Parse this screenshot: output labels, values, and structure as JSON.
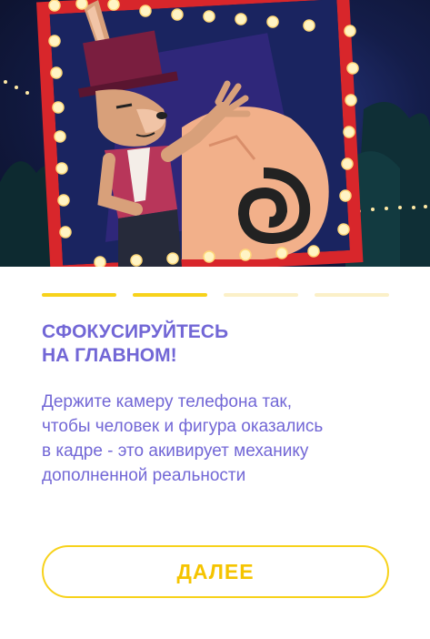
{
  "hero": {
    "image_name": "ar-rabbit-illustration",
    "colors": {
      "frame": "#d8262b",
      "bulb": "#fff4c4",
      "sky": "#141d4a"
    }
  },
  "progress": {
    "total": 4,
    "current": 2
  },
  "title": {
    "line1": "СФОКУСИРУЙТЕСЬ",
    "line2": "НА ГЛАВНОМ!"
  },
  "description": {
    "line1": "Держите камеру телефона так,",
    "line2": "чтобы человек и фигура оказались",
    "line3": "в кадре - это акивирует механику",
    "line4": "дополненной реальности"
  },
  "button": {
    "label": "ДАЛЕЕ"
  },
  "colors": {
    "accent": "#f7d21b",
    "text": "#7267d6",
    "inactive": "#fbf0c8"
  }
}
